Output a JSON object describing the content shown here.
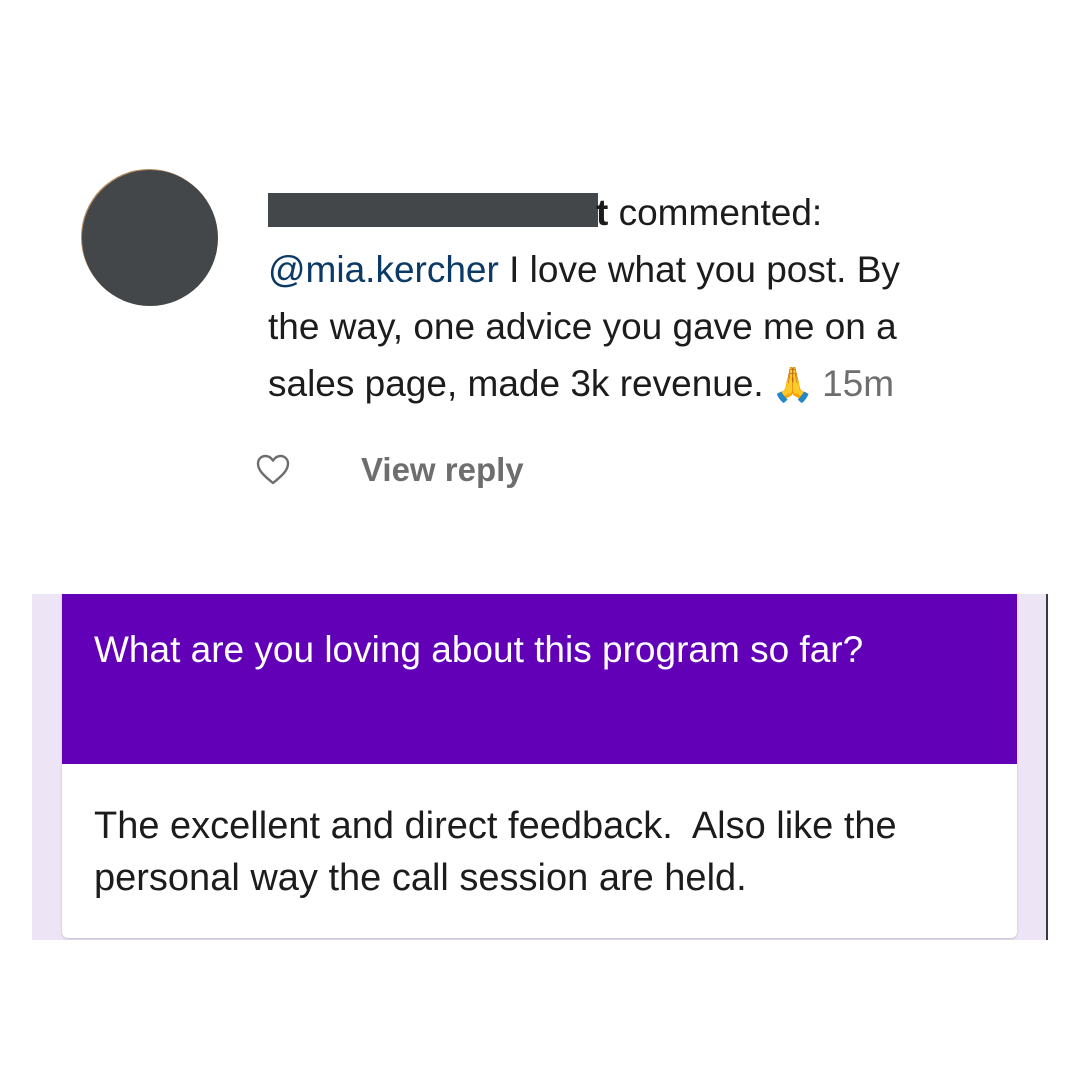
{
  "comment": {
    "username_suffix": "t",
    "action_text": "commented:",
    "mention": "@mia.kercher",
    "text_line1_after_mention": " I love what you post. By",
    "text_line2": "the way, one advice you gave me on a",
    "text_line3": "sales page, made 3k revenue.",
    "emoji": "🙏",
    "timestamp": "15m",
    "heart_icon": "heart-outline-icon",
    "view_reply_label": "View reply"
  },
  "form": {
    "question": "What are you loving about this program so far?",
    "answer": "The excellent and direct feedback.  Also like the personal way the call session are held.",
    "question_bg": "#6200b8",
    "page_bg": "#ede4f5"
  }
}
